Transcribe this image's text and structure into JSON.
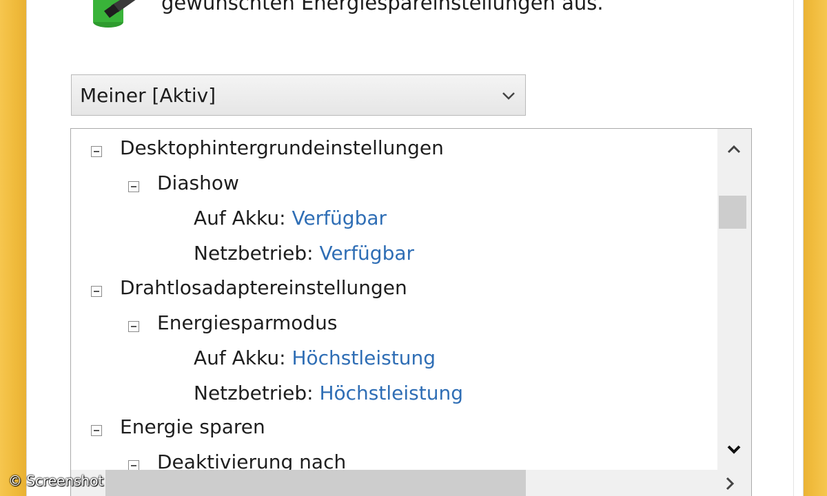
{
  "intro": {
    "text": "gewünschten Energiespareinstellungen aus."
  },
  "plan_select": {
    "value": "Meiner [Aktiv]"
  },
  "tree": {
    "desktop": {
      "label": "Desktophintergrundeinstellungen",
      "slideshow": {
        "label": "Diashow",
        "battery_label": "Auf Akku:",
        "battery_value": "Verfügbar",
        "ac_label": "Netzbetrieb:",
        "ac_value": "Verfügbar"
      }
    },
    "wireless": {
      "label": "Drahtlosadaptereinstellungen",
      "power_mode": {
        "label": "Energiesparmodus",
        "battery_label": "Auf Akku:",
        "battery_value": "Höchstleistung",
        "ac_label": "Netzbetrieb:",
        "ac_value": "Höchstleistung"
      }
    },
    "sleep": {
      "label": "Energie sparen",
      "sleep_after": {
        "label": "Deaktivierung nach"
      }
    }
  },
  "watermark": "© Screenshot",
  "colors": {
    "link": "#2f6eb5",
    "frame": "#f0bb3c"
  }
}
